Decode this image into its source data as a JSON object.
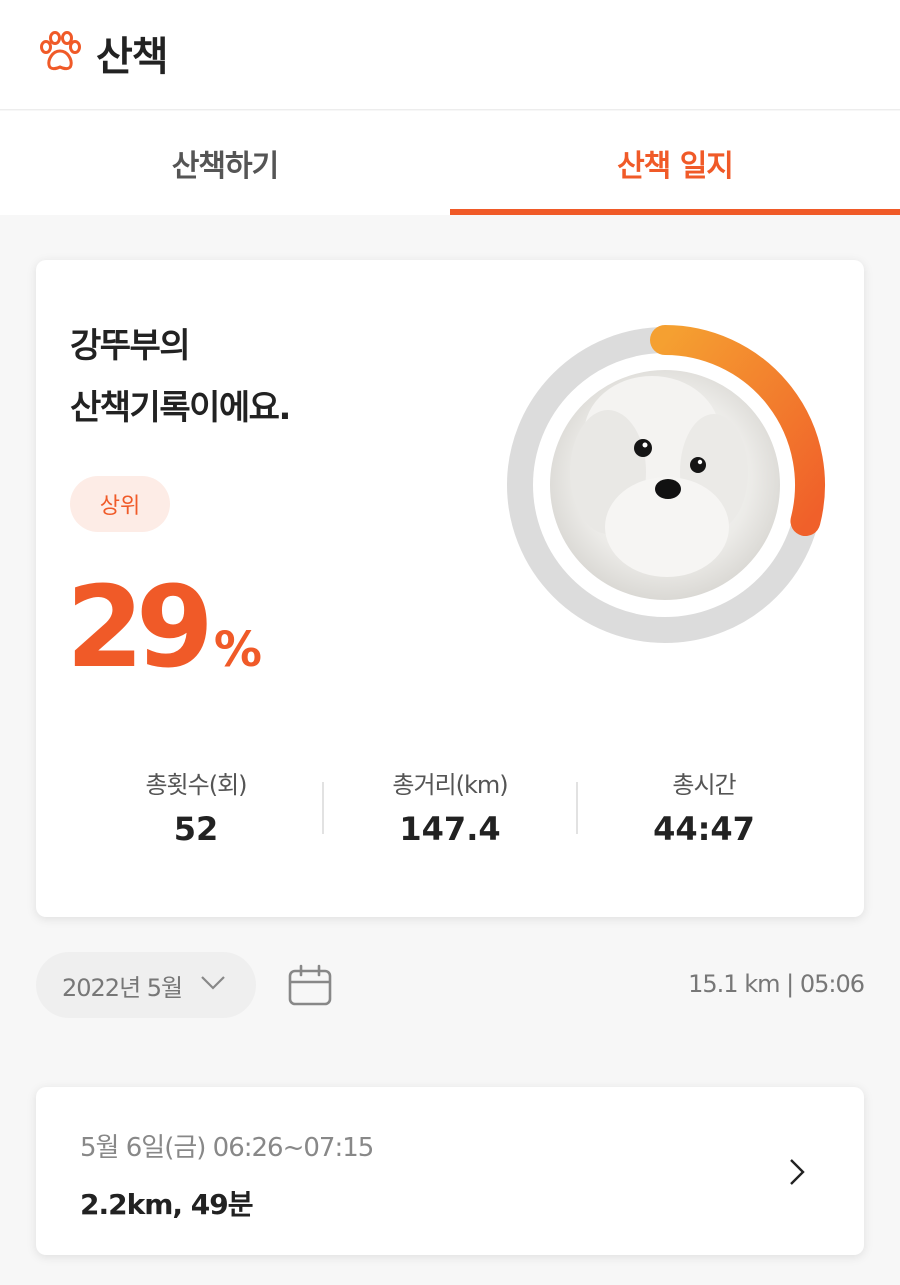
{
  "header": {
    "title": "산책",
    "icon": "paw-icon",
    "accent": "#f05a28"
  },
  "tabs": [
    {
      "label": "산책하기",
      "active": false
    },
    {
      "label": "산책 일지",
      "active": true
    }
  ],
  "summary_card": {
    "headline_line1": "강뚜부의",
    "headline_line2": "산책기록이에요.",
    "badge": "상위",
    "percent": "29",
    "percent_unit": "%",
    "ring_progress": 0.29,
    "ring_colors": {
      "track": "#dcdcdc",
      "progress_start": "#f5a031",
      "progress_end": "#f0602a"
    },
    "stats": [
      {
        "label": "총횟수(회)",
        "value": "52"
      },
      {
        "label": "총거리(km)",
        "value": "147.4"
      },
      {
        "label": "총시간",
        "value": "44:47"
      }
    ]
  },
  "filter": {
    "month": "2022년 5월",
    "summary": "15.1 km | 05:06"
  },
  "records": [
    {
      "date": "5월 6일(금) 06:26~07:15",
      "distance": "2.2km, 49분"
    }
  ]
}
